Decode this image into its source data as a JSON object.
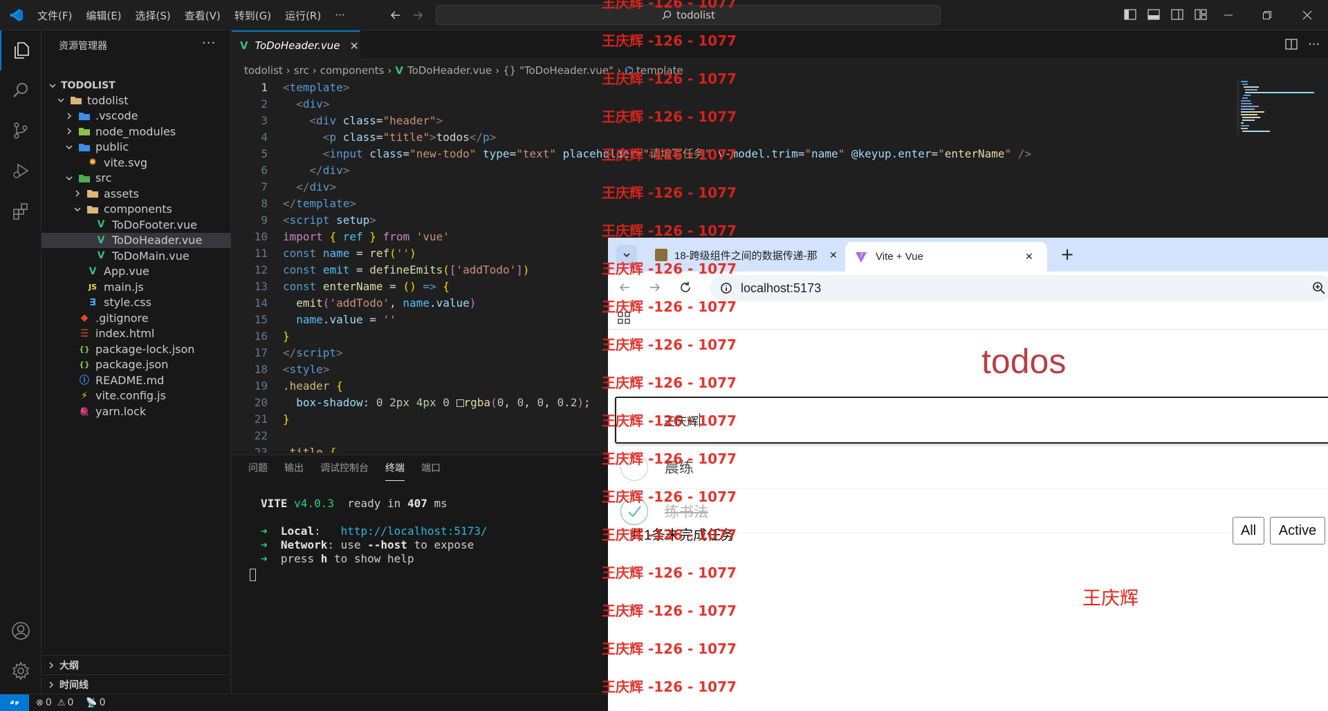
{
  "titlebar": {
    "menus": [
      "文件(F)",
      "编辑(E)",
      "选择(S)",
      "查看(V)",
      "转到(G)",
      "运行(R)",
      "···"
    ],
    "search": "todolist"
  },
  "sidebar": {
    "title": "资源管理器",
    "more": "···",
    "root": "TODOLIST",
    "items": [
      {
        "label": "todolist",
        "depth": 1,
        "type": "folder-open"
      },
      {
        "label": ".vscode",
        "depth": 2,
        "type": "folder"
      },
      {
        "label": "node_modules",
        "depth": 2,
        "type": "folder"
      },
      {
        "label": "public",
        "depth": 2,
        "type": "folder-open"
      },
      {
        "label": "vite.svg",
        "depth": 3,
        "type": "svg"
      },
      {
        "label": "src",
        "depth": 2,
        "type": "folder-open"
      },
      {
        "label": "assets",
        "depth": 3,
        "type": "folder"
      },
      {
        "label": "components",
        "depth": 3,
        "type": "folder-open"
      },
      {
        "label": "ToDoFooter.vue",
        "depth": 4,
        "type": "vue"
      },
      {
        "label": "ToDoHeader.vue",
        "depth": 4,
        "type": "vue"
      },
      {
        "label": "ToDoMain.vue",
        "depth": 4,
        "type": "vue"
      },
      {
        "label": "App.vue",
        "depth": 3,
        "type": "vue"
      },
      {
        "label": "main.js",
        "depth": 3,
        "type": "js"
      },
      {
        "label": "style.css",
        "depth": 3,
        "type": "css"
      },
      {
        "label": ".gitignore",
        "depth": 2,
        "type": "git"
      },
      {
        "label": "index.html",
        "depth": 2,
        "type": "html"
      },
      {
        "label": "package-lock.json",
        "depth": 2,
        "type": "json"
      },
      {
        "label": "package.json",
        "depth": 2,
        "type": "json"
      },
      {
        "label": "README.md",
        "depth": 2,
        "type": "info"
      },
      {
        "label": "vite.config.js",
        "depth": 2,
        "type": "vite"
      },
      {
        "label": "yarn.lock",
        "depth": 2,
        "type": "yarn"
      }
    ],
    "outline": "大纲",
    "timeline": "时间线"
  },
  "editor": {
    "tab": "ToDoHeader.vue",
    "breadcrumb": [
      "todolist",
      "src",
      "components",
      "ToDoHeader.vue",
      "{} \"ToDoHeader.vue\"",
      "template"
    ],
    "line_numbers": [
      "1",
      "2",
      "3",
      "4",
      "5",
      "6",
      "7",
      "8",
      "9",
      "10",
      "11",
      "12",
      "13",
      "14",
      "15",
      "16",
      "17",
      "18",
      "19",
      "20",
      "21",
      "22",
      "23"
    ]
  },
  "panel": {
    "tabs": [
      "问题",
      "输出",
      "调试控制台",
      "终端",
      "端口"
    ],
    "active_tab": "终端",
    "vite_version": "v4.0.3",
    "ready_ms": "407",
    "local_url": "http://localhost:5173/"
  },
  "statusbar": {
    "errors": "0",
    "warnings": "0",
    "ports": "0"
  },
  "browser": {
    "tab1": "18-跨级组件之间的数据传递-那",
    "tab2": "Vite + Vue",
    "url": "localhost:5173",
    "page": {
      "title": "todos",
      "input_value": "王庆辉",
      "items": [
        {
          "text": "晨练",
          "done": false
        },
        {
          "text": "练书法",
          "done": true
        }
      ],
      "footer_count": "共1条未完成任务",
      "btn_all": "All",
      "btn_active": "Active",
      "owner": "王庆辉"
    }
  },
  "watermark": "王庆辉 -126 - 1077",
  "colors": {
    "accent": "#0078d4",
    "todo_title": "#b83f45",
    "watermark": "#e3241c",
    "browser_tabbar": "#d3e3fd"
  }
}
